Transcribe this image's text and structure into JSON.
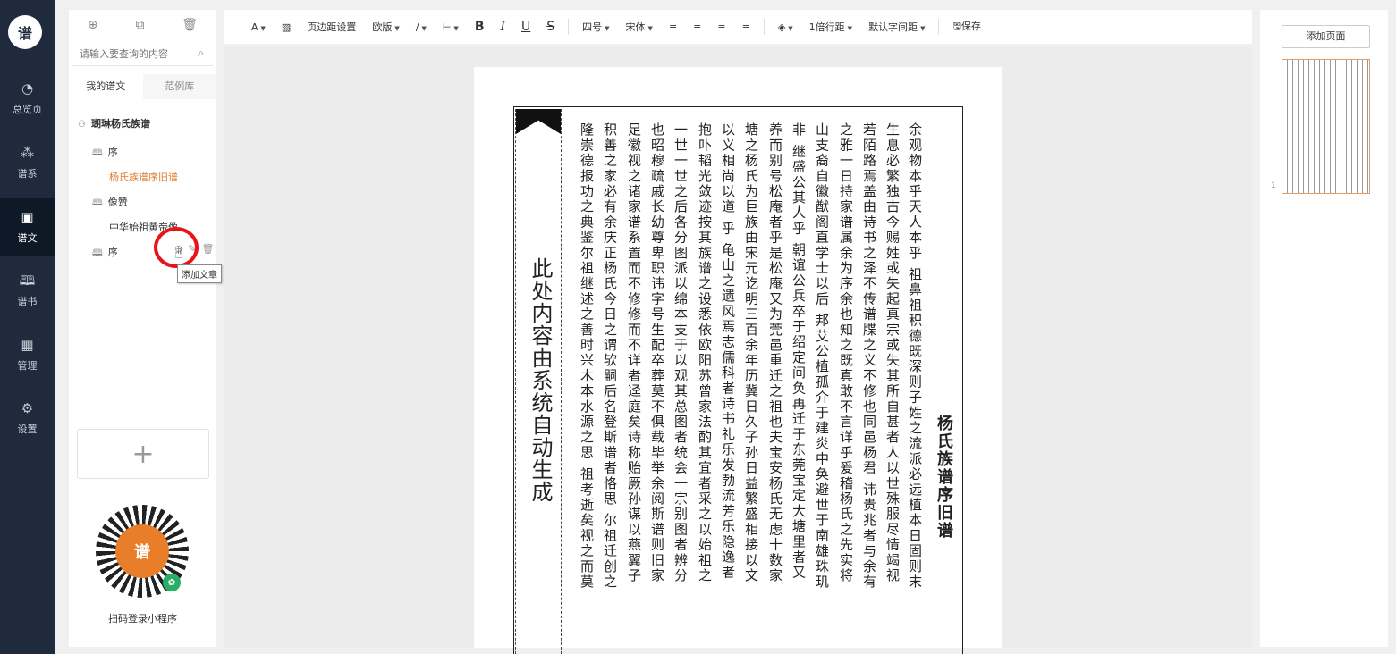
{
  "nav": {
    "logo": "谱",
    "items": [
      {
        "label": "总览页",
        "icon": "◔"
      },
      {
        "label": "谱系",
        "icon": "⁂"
      },
      {
        "label": "谱文",
        "icon": "▣"
      },
      {
        "label": "谱书",
        "icon": "🕮"
      },
      {
        "label": "管理",
        "icon": "▦"
      },
      {
        "label": "设置",
        "icon": "⚙"
      }
    ]
  },
  "tree_panel": {
    "tools": [
      "⊕",
      "⧉",
      "🗑"
    ],
    "search_placeholder": "请输入要查询的内容",
    "search_icon": "⌕",
    "tabs": [
      "我的谱文",
      "范例库"
    ],
    "root": "瑚琳杨氏族谱",
    "nodes": [
      "序",
      "杨氏族谱序旧谱",
      "像赞",
      "中华始祖黄帝像",
      "序"
    ],
    "row_actions": [
      "⊕",
      "✎",
      "🗑"
    ],
    "tooltip": "添加文章",
    "add_button": "+",
    "qr_center": "谱",
    "qr_badge": "✿",
    "qr_caption": "扫码登录小程序"
  },
  "toolbar": {
    "text_box": "A",
    "image": "▨",
    "margin": "页边距设置",
    "style": "欧版",
    "line": "∕",
    "separator": "⊢",
    "bold": "B",
    "italic": "I",
    "underline": "U",
    "strike": "S",
    "font_size": "四号",
    "font_family": "宋体",
    "align_left": "≡",
    "align_center": "≡",
    "align_right": "≡",
    "align_justify": "≡",
    "layers": "◈",
    "line_spacing": "1倍行距",
    "char_spacing": "默认字间距",
    "save": "保存"
  },
  "page": {
    "banner_text": "此处内容由系统自动生成",
    "title": "杨氏族谱序旧谱",
    "columns": [
      "余观物本乎天人本乎 祖鼻祖积德既深则子姓之流派必远植本日固则末",
      "生息必繁独古今赐姓或失起真宗或失其所自甚者人以世殊服尽情竭视",
      "若陌路焉盖由诗书之泽不传谱牒之义不修也同邑杨君 讳贵兆者与余有",
      "之雅一日持家谱属余为序余也知之既真敢不言详乎爰稽杨氏之先实将",
      "山支裔自徽猷阁直学士以后 邦艾公植孤介于建炎中奂避世于南雄珠玑",
      "非 继盛公其人乎 朝谊公兵卒于绍定间奂再迁于东莞宝定大塘里者又",
      "养而别号松庵者乎是松庵又为莞邑重迁之祖也夫宝安杨氏无虑十数家",
      "塘之杨氏为巨族由宋元讫明三百余年历冀日久子孙日益繁盛相接以文",
      "以义相尚以道 乎 龟山之遗风焉志儒科者诗书礼乐发勃流芳乐隐逸者",
      "抱卟韬光敛迹按其族谱之设悉依欧阳苏曾家法酌其宜者采之以始祖之",
      "一世一世之后各分图派以绵本支于以观其总图者统会一宗别图者辨分",
      "也昭穆疏戚长幼尊卑职讳字号生配卒葬莫不俱载毕举余阅斯谱则旧家",
      "足徽视之诸家谱系置而不修修而不详者迳庭矣诗称贻厥孙谋以燕翼子",
      "积善之家必有余庆正杨氏今日之谓欤嗣后名登斯谱者恪思 尔祖迁创之",
      "隆崇德报功之典鉴尔祖继述之善时兴木本水源之思 祖考逝矣视之而莫"
    ]
  },
  "right_panel": {
    "add_page": "添加页面",
    "page_number": "1"
  }
}
